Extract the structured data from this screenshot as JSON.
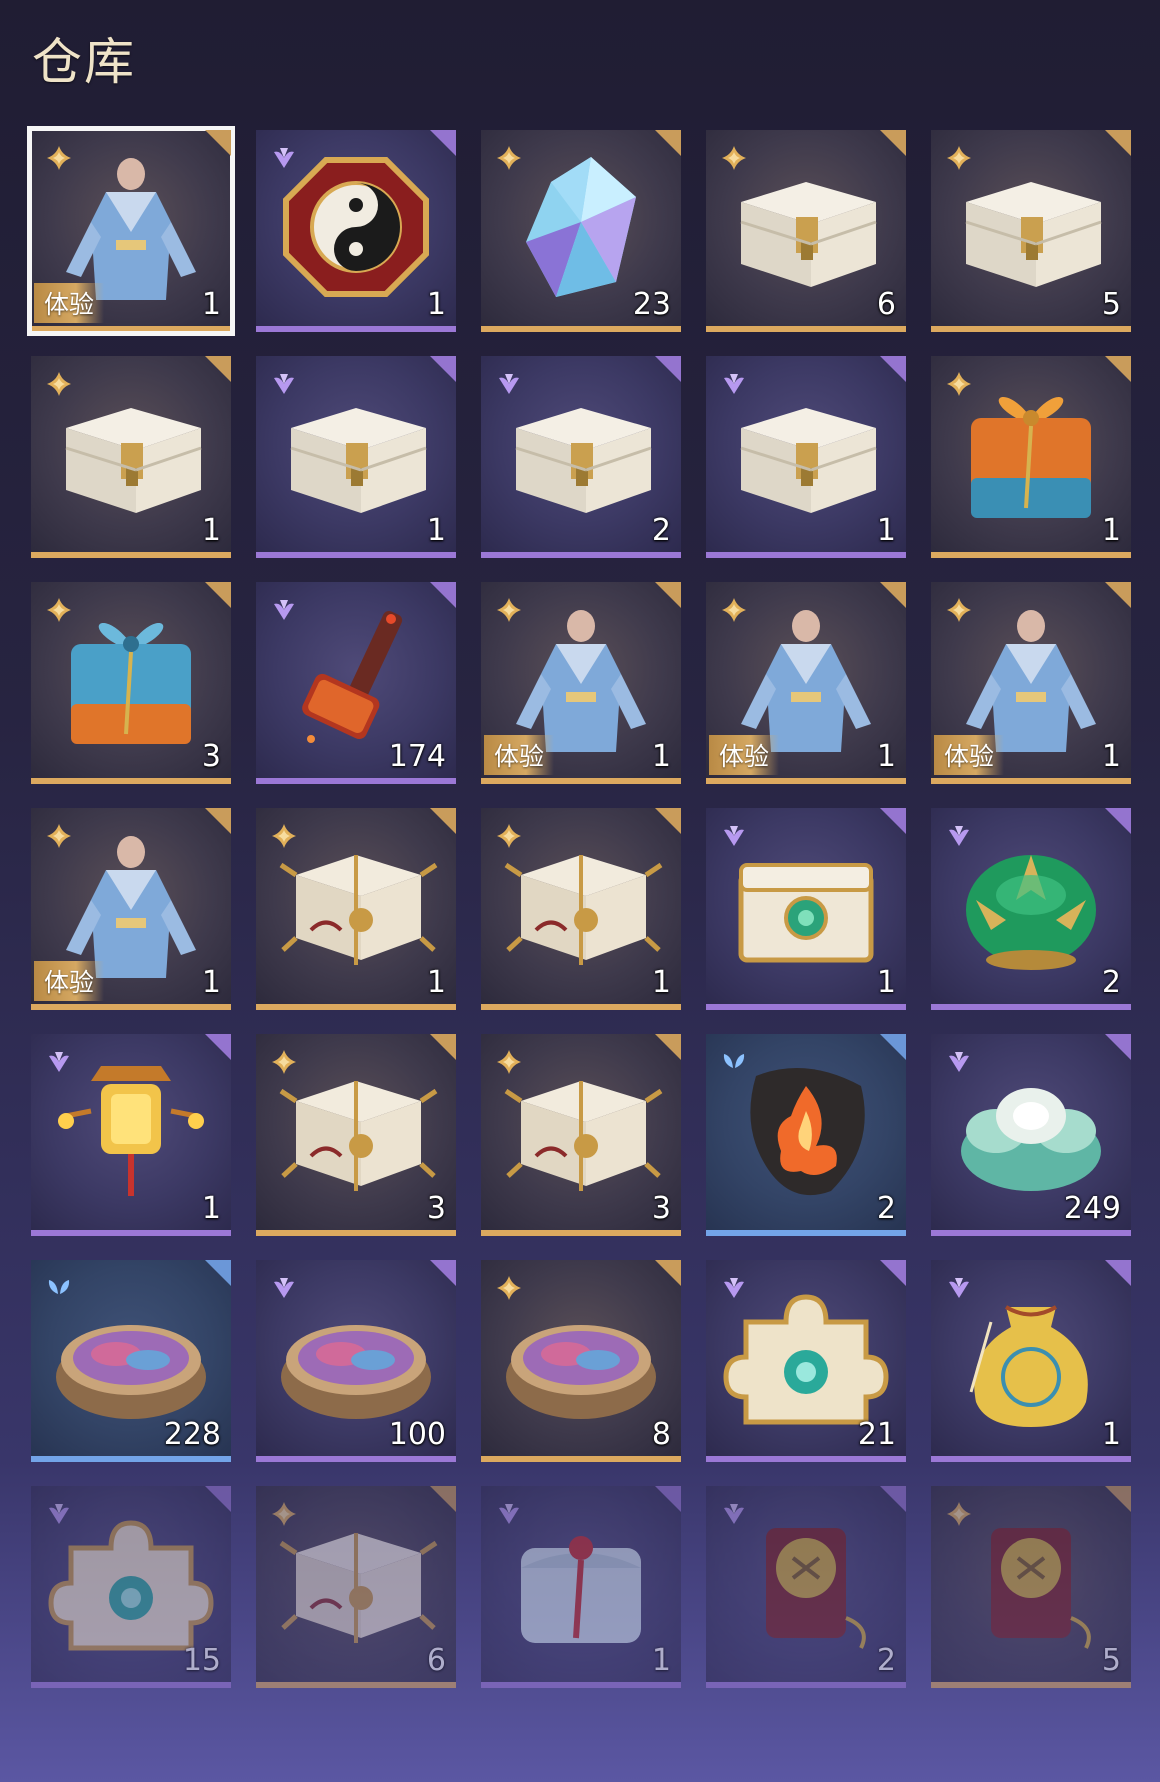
{
  "header": {
    "title": "仓库"
  },
  "inventory": {
    "items": [
      {
        "rarity": "gold",
        "rarity_icon": "four-petal-star-icon",
        "art": "outfit-icon",
        "qty": "1",
        "tag": "体验",
        "selected": true
      },
      {
        "rarity": "purple",
        "rarity_icon": "three-petal-icon",
        "art": "octagon-charm-icon",
        "qty": "1"
      },
      {
        "rarity": "gold",
        "rarity_icon": "four-petal-star-icon",
        "art": "crystal-icon",
        "qty": "23"
      },
      {
        "rarity": "gold",
        "rarity_icon": "four-petal-star-icon",
        "art": "white-chest-icon",
        "qty": "6"
      },
      {
        "rarity": "gold",
        "rarity_icon": "four-petal-star-icon",
        "art": "white-chest-icon",
        "qty": "5"
      },
      {
        "rarity": "gold",
        "rarity_icon": "four-petal-star-icon",
        "art": "white-chest-icon",
        "qty": "1"
      },
      {
        "rarity": "purple",
        "rarity_icon": "three-petal-icon",
        "art": "white-chest-icon",
        "qty": "1"
      },
      {
        "rarity": "purple",
        "rarity_icon": "three-petal-icon",
        "art": "white-chest-icon",
        "qty": "2"
      },
      {
        "rarity": "purple",
        "rarity_icon": "three-petal-icon",
        "art": "white-chest-icon",
        "qty": "1"
      },
      {
        "rarity": "gold",
        "rarity_icon": "four-petal-star-icon",
        "art": "orange-gift-box-icon",
        "qty": "1"
      },
      {
        "rarity": "gold",
        "rarity_icon": "four-petal-star-icon",
        "art": "blue-gift-box-icon",
        "qty": "3"
      },
      {
        "rarity": "purple",
        "rarity_icon": "three-petal-icon",
        "art": "hammer-icon",
        "qty": "174"
      },
      {
        "rarity": "gold",
        "rarity_icon": "four-petal-star-icon",
        "art": "outfit-icon",
        "qty": "1",
        "tag": "体验"
      },
      {
        "rarity": "gold",
        "rarity_icon": "four-petal-star-icon",
        "art": "outfit-icon",
        "qty": "1",
        "tag": "体验"
      },
      {
        "rarity": "gold",
        "rarity_icon": "four-petal-star-icon",
        "art": "outfit-icon",
        "qty": "1",
        "tag": "体验"
      },
      {
        "rarity": "gold",
        "rarity_icon": "four-petal-star-icon",
        "art": "outfit-icon",
        "qty": "1",
        "tag": "体验"
      },
      {
        "rarity": "gold",
        "rarity_icon": "four-petal-star-icon",
        "art": "ornate-chest-icon",
        "qty": "1"
      },
      {
        "rarity": "gold",
        "rarity_icon": "four-petal-star-icon",
        "art": "ornate-chest-icon",
        "qty": "1"
      },
      {
        "rarity": "purple",
        "rarity_icon": "three-petal-icon",
        "art": "jade-chest-icon",
        "qty": "1"
      },
      {
        "rarity": "purple",
        "rarity_icon": "three-petal-icon",
        "art": "lotus-box-icon",
        "qty": "2"
      },
      {
        "rarity": "purple",
        "rarity_icon": "three-petal-icon",
        "art": "lantern-icon",
        "qty": "1"
      },
      {
        "rarity": "gold",
        "rarity_icon": "four-petal-star-icon",
        "art": "ornate-chest-icon",
        "qty": "3"
      },
      {
        "rarity": "gold",
        "rarity_icon": "four-petal-star-icon",
        "art": "ornate-chest-icon",
        "qty": "3"
      },
      {
        "rarity": "blue",
        "rarity_icon": "two-petal-icon",
        "art": "flame-emblem-icon",
        "qty": "2"
      },
      {
        "rarity": "purple",
        "rarity_icon": "three-petal-icon",
        "art": "jade-flower-icon",
        "qty": "249"
      },
      {
        "rarity": "blue",
        "rarity_icon": "two-petal-icon",
        "art": "powder-bowl-icon",
        "qty": "228"
      },
      {
        "rarity": "purple",
        "rarity_icon": "three-petal-icon",
        "art": "powder-bowl-icon",
        "qty": "100"
      },
      {
        "rarity": "gold",
        "rarity_icon": "four-petal-star-icon",
        "art": "powder-bowl-icon",
        "qty": "8"
      },
      {
        "rarity": "purple",
        "rarity_icon": "three-petal-icon",
        "art": "puzzle-piece-icon",
        "qty": "21"
      },
      {
        "rarity": "purple",
        "rarity_icon": "three-petal-icon",
        "art": "pouch-icon",
        "qty": "1"
      },
      {
        "rarity": "purple",
        "rarity_icon": "three-petal-icon",
        "art": "puzzle-piece-icon",
        "qty": "15",
        "faded": true
      },
      {
        "rarity": "gold",
        "rarity_icon": "four-petal-star-icon",
        "art": "ornate-chest-icon",
        "qty": "6",
        "faded": true
      },
      {
        "rarity": "purple",
        "rarity_icon": "three-petal-icon",
        "art": "cloth-bundle-icon",
        "qty": "1",
        "faded": true
      },
      {
        "rarity": "purple",
        "rarity_icon": "three-petal-icon",
        "art": "bell-pendant-icon",
        "qty": "2",
        "faded": true
      },
      {
        "rarity": "gold",
        "rarity_icon": "four-petal-star-icon",
        "art": "bell-pendant-icon",
        "qty": "5",
        "faded": true
      }
    ]
  },
  "colors": {
    "gold": "#dca95f",
    "purple": "#9b78d6",
    "blue": "#73a4e8"
  }
}
